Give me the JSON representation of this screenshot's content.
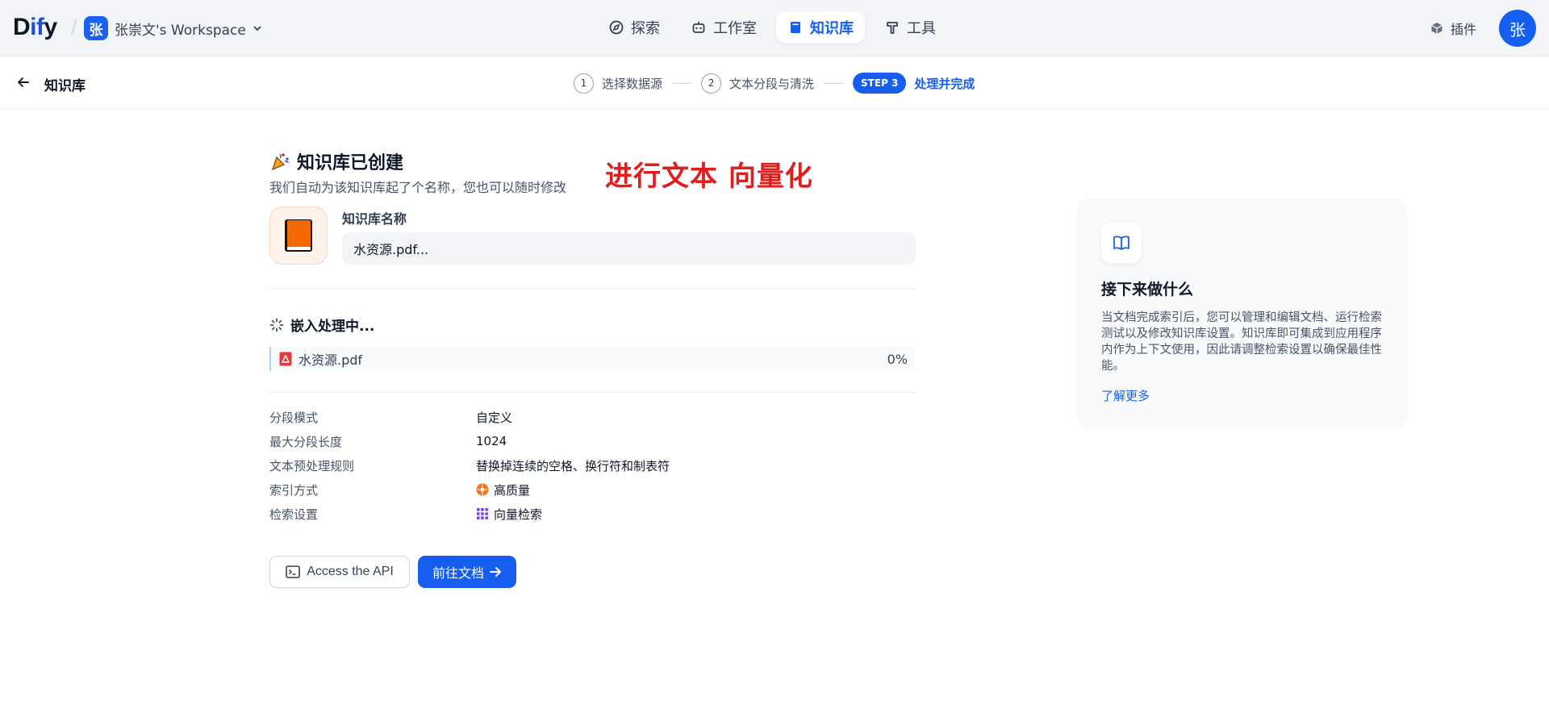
{
  "app": {
    "logo_prefix": "D",
    "logo_mid": "if",
    "logo_suffix": "y",
    "workspace_badge": "张",
    "workspace_name": "张崇文's Workspace"
  },
  "nav": {
    "tabs": [
      {
        "label": "探索",
        "icon": "compass-icon"
      },
      {
        "label": "工作室",
        "icon": "robot-icon"
      },
      {
        "label": "知识库",
        "icon": "book-icon",
        "active": true
      },
      {
        "label": "工具",
        "icon": "hammer-icon"
      }
    ],
    "plugin_label": "插件",
    "avatar_letter": "张"
  },
  "subbar": {
    "title": "知识库",
    "steps": [
      {
        "num": "1",
        "label": "选择数据源"
      },
      {
        "num": "2",
        "label": "文本分段与清洗"
      },
      {
        "badge": "STEP 3",
        "label": "处理并完成"
      }
    ]
  },
  "main": {
    "created_title": "知识库已创建",
    "created_desc": "我们自动为该知识库起了个名称，您也可以随时修改",
    "overlay_text": "进行文本 向量化",
    "kb_name_label": "知识库名称",
    "kb_name_value": "水资源.pdf...",
    "embedding_title": "嵌入处理中...",
    "file": {
      "name": "水资源.pdf",
      "progress": "0%"
    },
    "meta": [
      {
        "key": "分段模式",
        "value": "自定义"
      },
      {
        "key": "最大分段长度",
        "value": "1024"
      },
      {
        "key": "文本预处理规则",
        "value": "替换掉连续的空格、换行符和制表符"
      },
      {
        "key": "索引方式",
        "value": "高质量",
        "icon": "sun-icon"
      },
      {
        "key": "检索设置",
        "value": "向量检索",
        "icon": "grid-icon"
      }
    ],
    "btn_api": "Access the API",
    "btn_doc": "前往文档"
  },
  "card": {
    "title": "接下来做什么",
    "text": "当文档完成索引后，您可以管理和编辑文档、运行检索测试以及修改知识库设置。知识库即可集成到应用程序内作为上下文使用，因此请调整检索设置以确保最佳性能。",
    "link": "了解更多"
  },
  "colors": {
    "accent": "#155eef",
    "overlay": "#e11d1d",
    "kb_icon_bg": "#fff2ea"
  }
}
